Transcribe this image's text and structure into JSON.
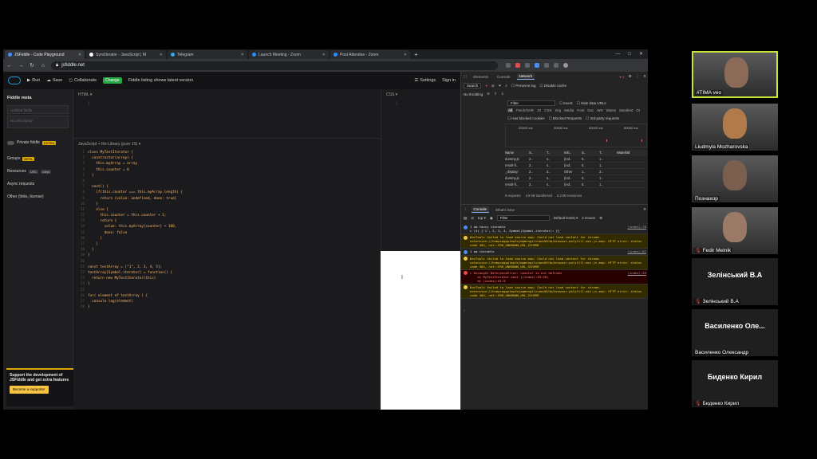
{
  "browser": {
    "tabs": [
      {
        "label": "JSFiddle - Code Playground",
        "active": true
      },
      {
        "label": "SyncIterator - JavaScript | M",
        "active": false
      },
      {
        "label": "Telegram",
        "active": false
      },
      {
        "label": "Launch Meeting - Zoom",
        "active": false
      },
      {
        "label": "Post Attendee - Zoom",
        "active": false
      }
    ],
    "url": "jsfiddle.net"
  },
  "jsfiddle": {
    "actions": {
      "run": "Run",
      "save": "Save",
      "collaborate": "Collaborate"
    },
    "change_badge": "Change",
    "status": "Fiddle listing shows latest version",
    "settings": "Settings",
    "signin": "Sign in",
    "sidebar": {
      "heading": "Fiddle meta",
      "title_placeholder": "Untitled fiddle",
      "desc_placeholder": "No description",
      "private": "Private fiddle",
      "private_badge": "EXTRA",
      "groups": "Groups",
      "groups_badge": "BETA",
      "resources": "Resources",
      "res_badge1": "URL",
      "res_badge2": "cdnjs",
      "async": "Async requests",
      "other": "Other (links, license)",
      "support_text": "Support the development of JSFiddle and get extra features",
      "support_button": "Become a supporter"
    },
    "panes": {
      "html": "HTML ▾",
      "css": "CSS ▾",
      "js": "JavaScript + No-Library (pure JS) ▾"
    },
    "code_lines": [
      "class MyTestIterator {",
      "  constructor(array) {",
      "    this.myArray = array",
      "    this.counter = 0",
      "  }",
      "",
      "  next() {",
      "    if(this.counter === this.myArray.length) {",
      "      return {value: undefined, done: true}",
      "    }",
      "    else {",
      "      this.counter = this.counter + 1;",
      "      return {",
      "        value: this.myArray[counter] + 100,",
      "        done: false",
      "      }",
      "    }",
      "  }",
      "}",
      "",
      "const testArray = [\"1\", 2, 3, 4, 5];",
      "testArray[Symbol.iterator] = function() {",
      "  return new MyTestIterator(this)",
      "}",
      "",
      "for( element of testArray ) {",
      "  console.log(element)",
      "}"
    ]
  },
  "devtools": {
    "tabs": [
      "Elements",
      "Console",
      "Network"
    ],
    "active_tab": "Network",
    "search_label": "Search",
    "throttle": "No throttling",
    "preserve_log": "Preserve log",
    "disable_cache": "Disable cache",
    "filter_placeholder": "Filter",
    "invert": "Invert",
    "hide_data": "Hide data URLs",
    "types": [
      "All",
      "Fetch/XHR",
      "JS",
      "CSS",
      "Img",
      "Media",
      "Font",
      "Doc",
      "WS",
      "Wasm",
      "Manifest",
      "Ot"
    ],
    "blocked_cookies": "Has blocked cookies",
    "blocked_requests": "Blocked Requests",
    "third_party": "3rd-party requests",
    "timeline_marks": [
      "20000 ms",
      "40000 ms",
      "60000 ms",
      "80000 ms"
    ],
    "table_headers": [
      "Name",
      "S..",
      "T..",
      "Initi..",
      "S..",
      "T..",
      "Waterfall"
    ],
    "rows": [
      [
        "dummy.js",
        "2..",
        "s..",
        "(ind..",
        "0..",
        "1.."
      ],
      [
        "result-fi..",
        "2..",
        "s..",
        "(ind..",
        "0..",
        "1.."
      ],
      [
        "_display/",
        "2..",
        "d..",
        "Other",
        "1..",
        "3.."
      ],
      [
        "dummy.js",
        "2..",
        "s..",
        "(ind..",
        "0..",
        "1.."
      ],
      [
        "result-fi..",
        "2..",
        "s..",
        "(ind..",
        "0..",
        "1.."
      ]
    ],
    "summary": [
      "9 requests",
      "4.9 kB transferred",
      "5.3 kB resources"
    ],
    "console_tabs": [
      "Console",
      "What's New"
    ],
    "console_context": "top",
    "console_filter": "Filter",
    "default_levels": "Default levels",
    "issues": "2 Issues",
    "messages": [
      {
        "type": "info",
        "text": "I am fancy iterable\n▸ (4) ['1', 2, 3, 4, Symbol(Symbol.iterator): ƒ]",
        "src": "(index):70"
      },
      {
        "type": "warn",
        "text": "DevTools failed to load source map: Could not load content for chrome-extension://hnmpcagpplmpfojmgmnngilcnanddlhb/browser-polyfill.min.js.map: HTTP error: status code 404, net::ERR_UNKNOWN_URL_SCHEME",
        "src": ""
      },
      {
        "type": "info",
        "text": "I am iterable",
        "src": "(index):62"
      },
      {
        "type": "warn",
        "text": "DevTools failed to load source map: Could not load content for chrome-extension://hnmpcagpplmpfojmgmnngilcnanddlhb/browser-polyfill.min.js.map: HTTP error: status code 404, net::ERR_UNKNOWN_URL_SCHEME",
        "src": ""
      },
      {
        "type": "err",
        "text": "▸ Uncaught ReferenceError: counter is not defined\n    at MyTestIterator.next ((index):49:38)\n    at (index):61:9",
        "src": "(index):49"
      },
      {
        "type": "warn",
        "text": "DevTools failed to load source map: Could not load content for chrome-extension://hnmpcagpplmpfojmgmnngilcnanddlhb/browser-polyfill.min.js.map: HTTP error: status code 404, net::ERR_UNKNOWN_URL_SCHEME",
        "src": ""
      }
    ]
  },
  "zoom": {
    "participants": [
      {
        "name": "#TIMA veo",
        "video": true,
        "muted": false,
        "speaking": true,
        "tone": "#8b6b57"
      },
      {
        "name": "Liudmyla Mozharovska",
        "video": true,
        "muted": false,
        "speaking": false,
        "tone": "#b07a4a"
      },
      {
        "name": "Познахор",
        "video": true,
        "muted": false,
        "speaking": false,
        "tone": "#7a5e4e"
      },
      {
        "name": "Fedir Melnik",
        "video": true,
        "muted": true,
        "speaking": false,
        "tone": "#9a7a66"
      },
      {
        "name": "Зелінський В.А",
        "big": "Зелінський В.А",
        "video": false,
        "muted": true,
        "speaking": false
      },
      {
        "name": "Василенко Олександр",
        "big": "Василенко Оле...",
        "video": false,
        "muted": false,
        "speaking": false
      },
      {
        "name": "Биденко Кирил",
        "big": "Биденко Кирил",
        "video": false,
        "muted": true,
        "speaking": false
      }
    ]
  }
}
